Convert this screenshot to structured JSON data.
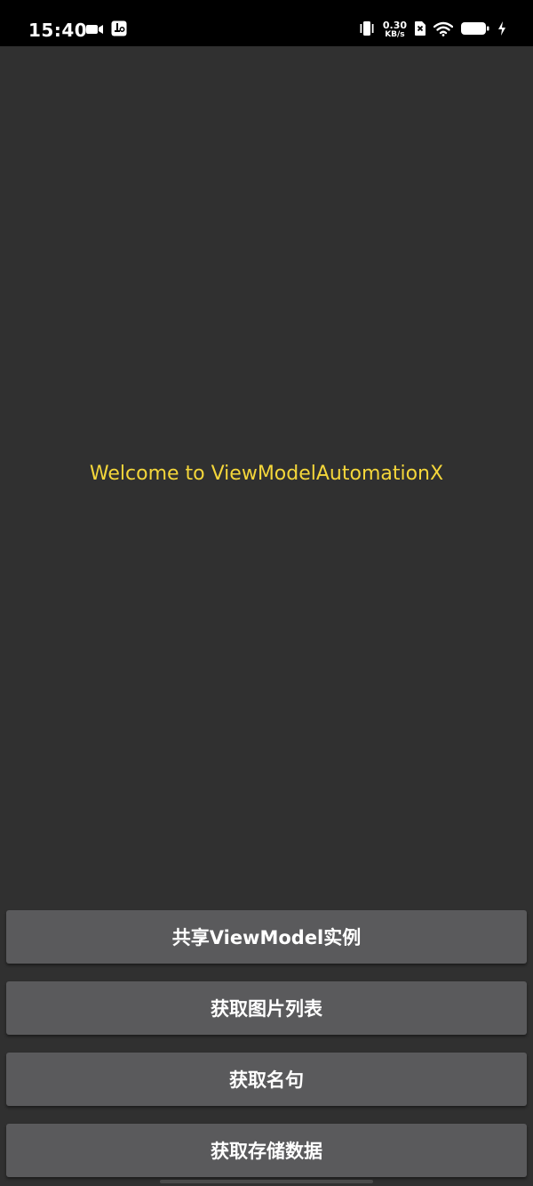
{
  "status_bar": {
    "time": "15:40",
    "net_speed_value": "0.30",
    "net_speed_unit": "KB/s",
    "icons": [
      "camera-icon",
      "usb-debug-icon",
      "vibrate-icon",
      "sim-off-icon",
      "wifi-icon",
      "battery-icon",
      "charging-icon"
    ]
  },
  "main": {
    "welcome_text": "Welcome to ViewModelAutomationX"
  },
  "buttons": {
    "share_viewmodel": "共享ViewModel实例",
    "get_image_list": "获取图片列表",
    "get_quote": "获取名句",
    "get_stored_data": "获取存储数据"
  },
  "colors": {
    "background": "#303030",
    "status_bar": "#000000",
    "welcome_text": "#f4d63a",
    "button": "#5a5a5c",
    "button_text": "#ffffff"
  }
}
